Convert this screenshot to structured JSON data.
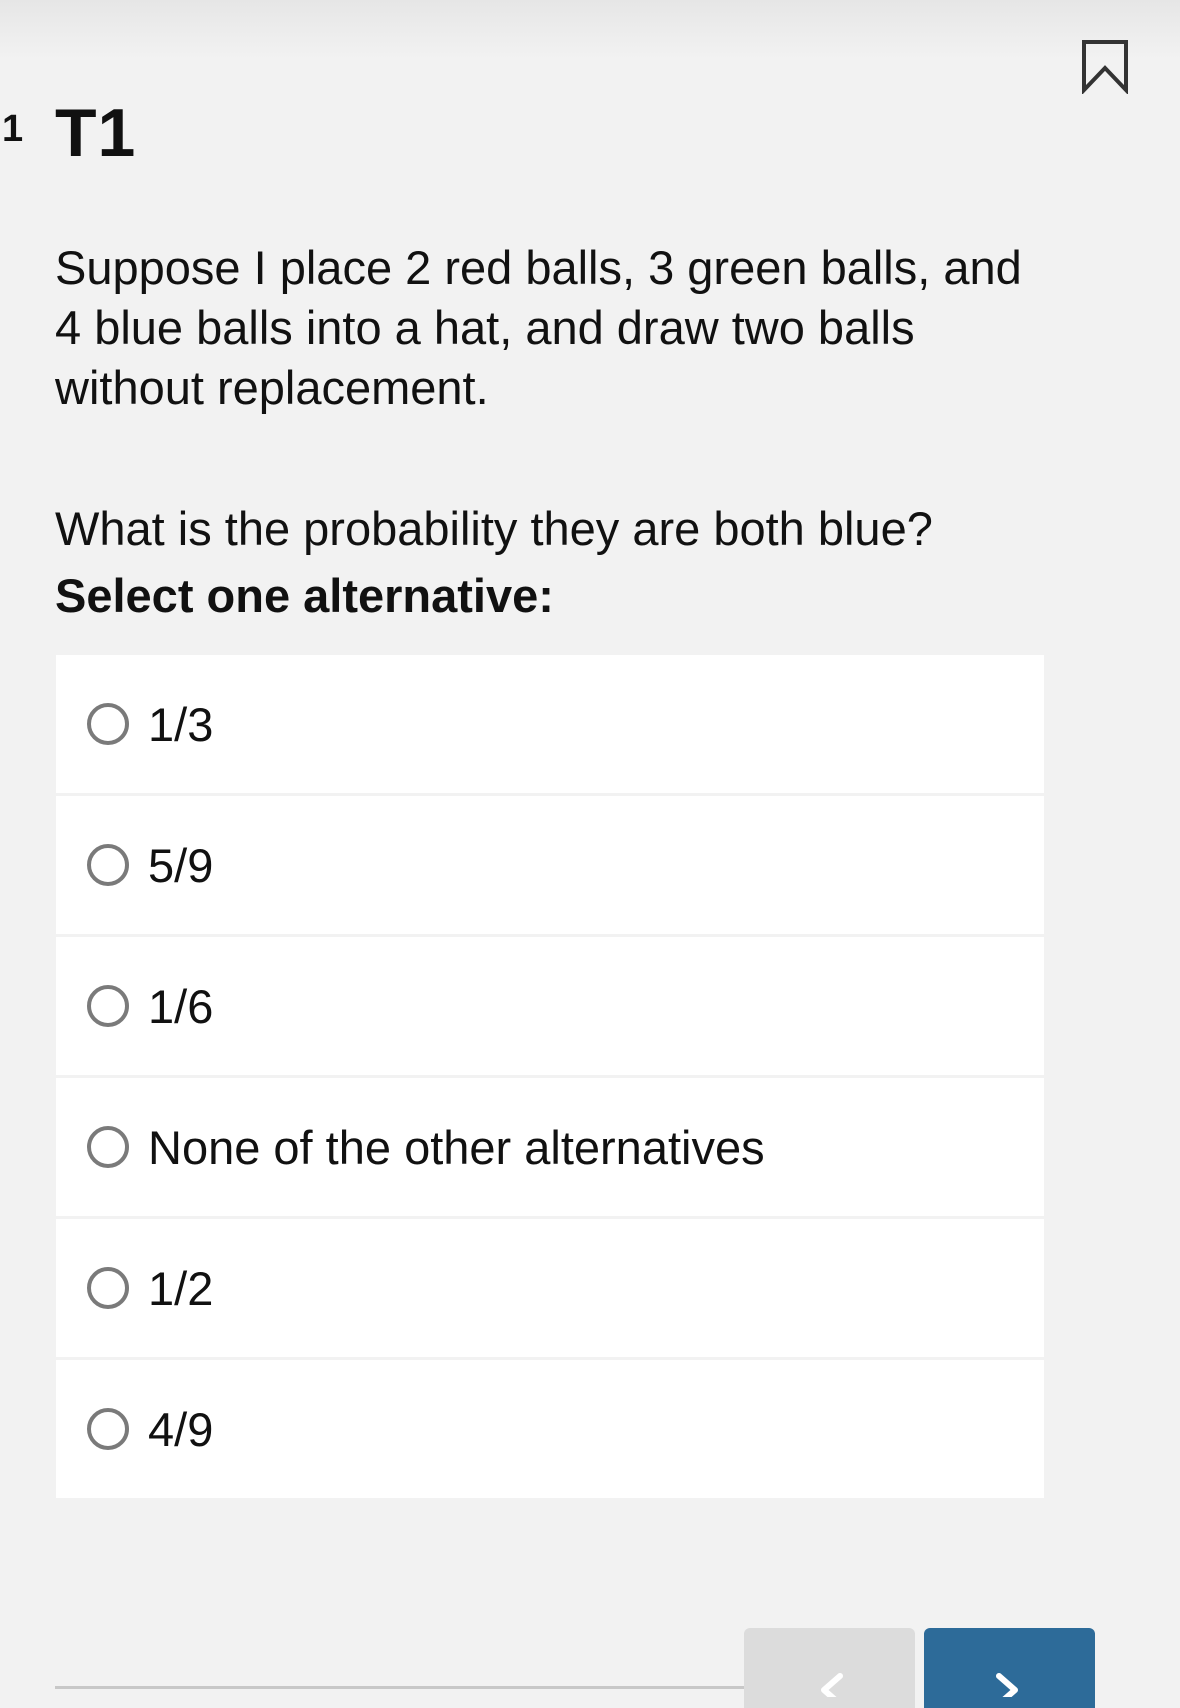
{
  "question": {
    "number": "1",
    "title": "T1",
    "prompt": "Suppose I place 2 red balls, 3 green balls, and 4 blue balls into a hat, and draw two balls without replacement.",
    "text": "What is the probability they are both blue?",
    "instruction": "Select one alternative:"
  },
  "options": [
    {
      "label": "1/3"
    },
    {
      "label": "5/9"
    },
    {
      "label": "1/6"
    },
    {
      "label": "None of the other alternatives"
    },
    {
      "label": "1/2"
    },
    {
      "label": "4/9"
    }
  ],
  "icons": {
    "bookmark": "bookmark-icon",
    "previous": "chevron-left-icon",
    "next": "chevron-right-icon"
  },
  "colors": {
    "background": "#f2f2f2",
    "next_button": "#2d6b99",
    "prev_button": "#dcdcdc",
    "radio_border": "#7a7a7a"
  }
}
